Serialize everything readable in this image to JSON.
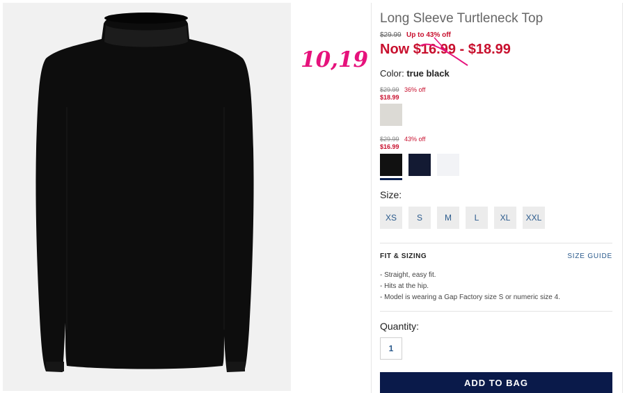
{
  "product": {
    "title": "Long Sleeve Turtleneck Top",
    "original_price": "$29.99",
    "discount": "Up to 43% off",
    "now_price": "Now $16.99 - $18.99"
  },
  "annotation": "10,19",
  "color": {
    "label": "Color:",
    "selected": "true black"
  },
  "swatch_groups": [
    {
      "original": "$29.99",
      "off": "36% off",
      "price": "$18.99",
      "swatches": [
        {
          "name": "heather-oatmeal",
          "color": "#dcdad5"
        }
      ]
    },
    {
      "original": "$29.99",
      "off": "43% off",
      "price": "$16.99",
      "swatches": [
        {
          "name": "true-black",
          "color": "#111111"
        },
        {
          "name": "navy",
          "color": "#131a33"
        },
        {
          "name": "white",
          "color": "#f2f3f6"
        }
      ]
    }
  ],
  "size": {
    "label": "Size:",
    "options": [
      "XS",
      "S",
      "M",
      "L",
      "XL",
      "XXL"
    ]
  },
  "fit": {
    "title": "FIT & SIZING",
    "size_guide": "SIZE GUIDE",
    "items": [
      "- Straight, easy fit.",
      "- Hits at the hip.",
      "- Model is wearing a Gap Factory size S or numeric size 4."
    ]
  },
  "quantity": {
    "label": "Quantity:",
    "value": "1"
  },
  "add_to_bag": "ADD TO BAG",
  "colors": {
    "sale_red": "#c8102e",
    "link_blue": "#2a5a8c",
    "button_navy": "#0a1a4a",
    "annotation_pink": "#e6127c"
  }
}
